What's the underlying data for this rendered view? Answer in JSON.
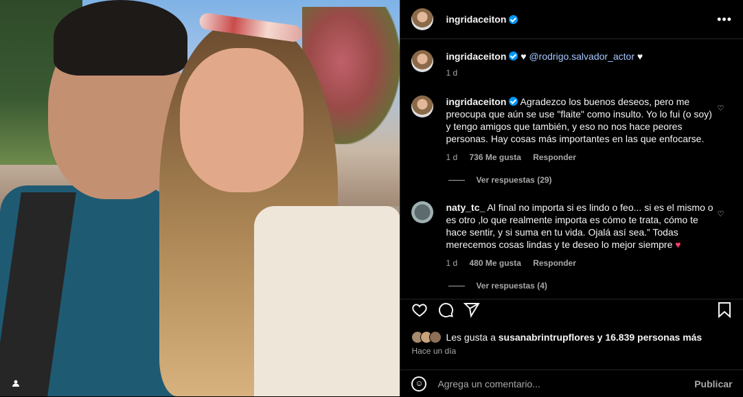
{
  "post": {
    "author": "ingridaceiton",
    "more_icon": "more-horizontal-icon"
  },
  "comments": [
    {
      "user": "ingridaceiton",
      "text_parts": [
        "♥ ",
        "@rodrigo.salvador_actor",
        " ♥"
      ],
      "time": "1 d"
    },
    {
      "user": "ingridaceiton",
      "text": "Agradezco los buenos deseos, pero me preocupa que aún se use \"flaite\" como insulto. Yo lo fui (o soy) y tengo amigos que también, y eso no nos hace peores personas. Hay cosas más importantes en las que enfocarse.",
      "time": "1 d",
      "likes": "736 Me gusta",
      "reply": "Responder",
      "view_replies": "Ver respuestas (29)"
    },
    {
      "user": "naty_tc_",
      "text": "Al final no importa si es lindo o feo... si es el mismo o es otro ,lo que realmente importa es cómo te trata, cómo te hace sentir, y si suma en tu vida. Ojalá así sea.” Todas merecemos cosas lindas y te deseo lo mejor siempre",
      "emoji": "♥",
      "time": "1 d",
      "likes": "480 Me gusta",
      "reply": "Responder",
      "view_replies": "Ver respuestas (4)"
    }
  ],
  "likes": {
    "prefix": "Les gusta a ",
    "user": "susanabrintrupflores",
    "suffix": " y 16.839 personas más"
  },
  "time_ago": "Hace un día",
  "comment_box": {
    "placeholder": "Agrega un comentario...",
    "publish": "Publicar"
  }
}
